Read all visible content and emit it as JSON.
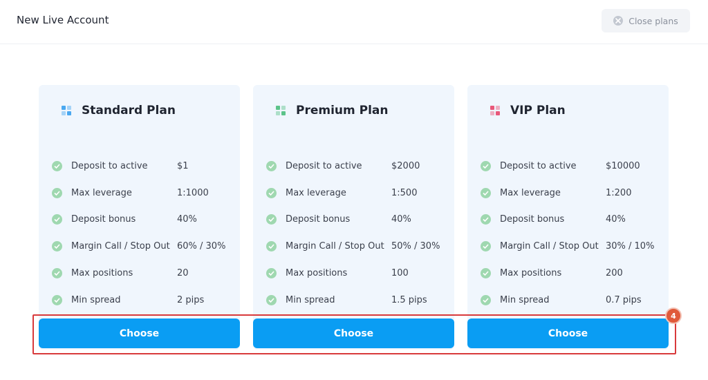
{
  "header": {
    "title": "New Live Account",
    "close_label": "Close plans"
  },
  "plans": [
    {
      "name": "Standard Plan",
      "icon_color": "#4aa8f0",
      "features": [
        {
          "label": "Deposit to active",
          "value": "$1"
        },
        {
          "label": "Max leverage",
          "value": "1:1000"
        },
        {
          "label": "Deposit bonus",
          "value": "40%"
        },
        {
          "label": "Margin Call / Stop Out",
          "value": "60% / 30%"
        },
        {
          "label": "Max positions",
          "value": "20"
        },
        {
          "label": "Min spread",
          "value": "2 pips"
        }
      ],
      "button_label": "Choose"
    },
    {
      "name": "Premium Plan",
      "icon_color": "#5cc38a",
      "features": [
        {
          "label": "Deposit to active",
          "value": "$2000"
        },
        {
          "label": "Max leverage",
          "value": "1:500"
        },
        {
          "label": "Deposit bonus",
          "value": "40%"
        },
        {
          "label": "Margin Call / Stop Out",
          "value": "50% / 30%"
        },
        {
          "label": "Max positions",
          "value": "100"
        },
        {
          "label": "Min spread",
          "value": "1.5 pips"
        }
      ],
      "button_label": "Choose"
    },
    {
      "name": "VIP Plan",
      "icon_color": "#e8587a",
      "features": [
        {
          "label": "Deposit to active",
          "value": "$10000"
        },
        {
          "label": "Max leverage",
          "value": "1:200"
        },
        {
          "label": "Deposit bonus",
          "value": "40%"
        },
        {
          "label": "Margin Call / Stop Out",
          "value": "30% / 10%"
        },
        {
          "label": "Max positions",
          "value": "200"
        },
        {
          "label": "Min spread",
          "value": "0.7 pips"
        }
      ],
      "button_label": "Choose"
    }
  ],
  "annotation": {
    "step_number": "4",
    "highlight_color": "#d8393b"
  },
  "colors": {
    "accent": "#0a9df3",
    "card_bg": "#f0f6fd",
    "check": "#9fd8b0"
  }
}
